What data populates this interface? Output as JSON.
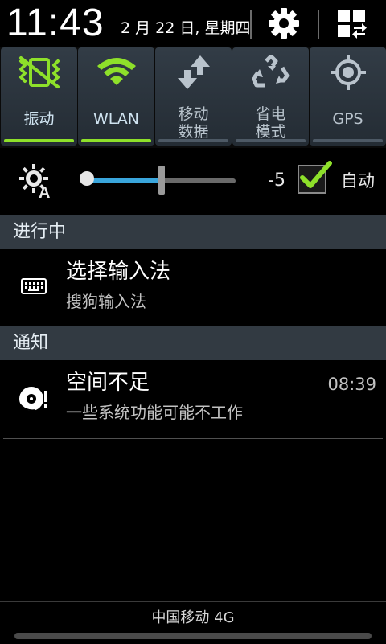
{
  "header": {
    "time": "11:43",
    "date": "2 月 22 日, 星期四",
    "settings_icon": "gear-icon",
    "toggle_panel_icon": "grid-toggle-icon"
  },
  "quick_toggles": [
    {
      "label": "振动",
      "icon": "vibrate-icon",
      "state": "on"
    },
    {
      "label": "WLAN",
      "icon": "wifi-icon",
      "state": "on"
    },
    {
      "label": "移动\n数据",
      "icon": "mobile-data-icon",
      "state": "off"
    },
    {
      "label": "省电\n模式",
      "icon": "power-saving-icon",
      "state": "off"
    },
    {
      "label": "GPS",
      "icon": "gps-icon",
      "state": "off"
    }
  ],
  "brightness": {
    "icon": "auto-brightness-icon",
    "level_fraction": 0.5,
    "value": "-5",
    "auto_checked": true,
    "auto_label": "自动"
  },
  "sections": {
    "ongoing": "进行中",
    "notifications": "通知"
  },
  "ongoing_items": [
    {
      "icon": "keyboard-icon",
      "title": "选择输入法",
      "text": "搜狗输入法"
    }
  ],
  "notification_items": [
    {
      "icon": "storage-warning-icon",
      "title": "空间不足",
      "text": "一些系统功能可能不工作",
      "time": "08:39"
    }
  ],
  "footer": {
    "carrier": "中国移动 4G"
  },
  "colors": {
    "accent_on": "#8ee02a",
    "slider_blue": "#3aa6dc",
    "section_bg": "#323a42",
    "tile_bg": "#2c353e"
  }
}
